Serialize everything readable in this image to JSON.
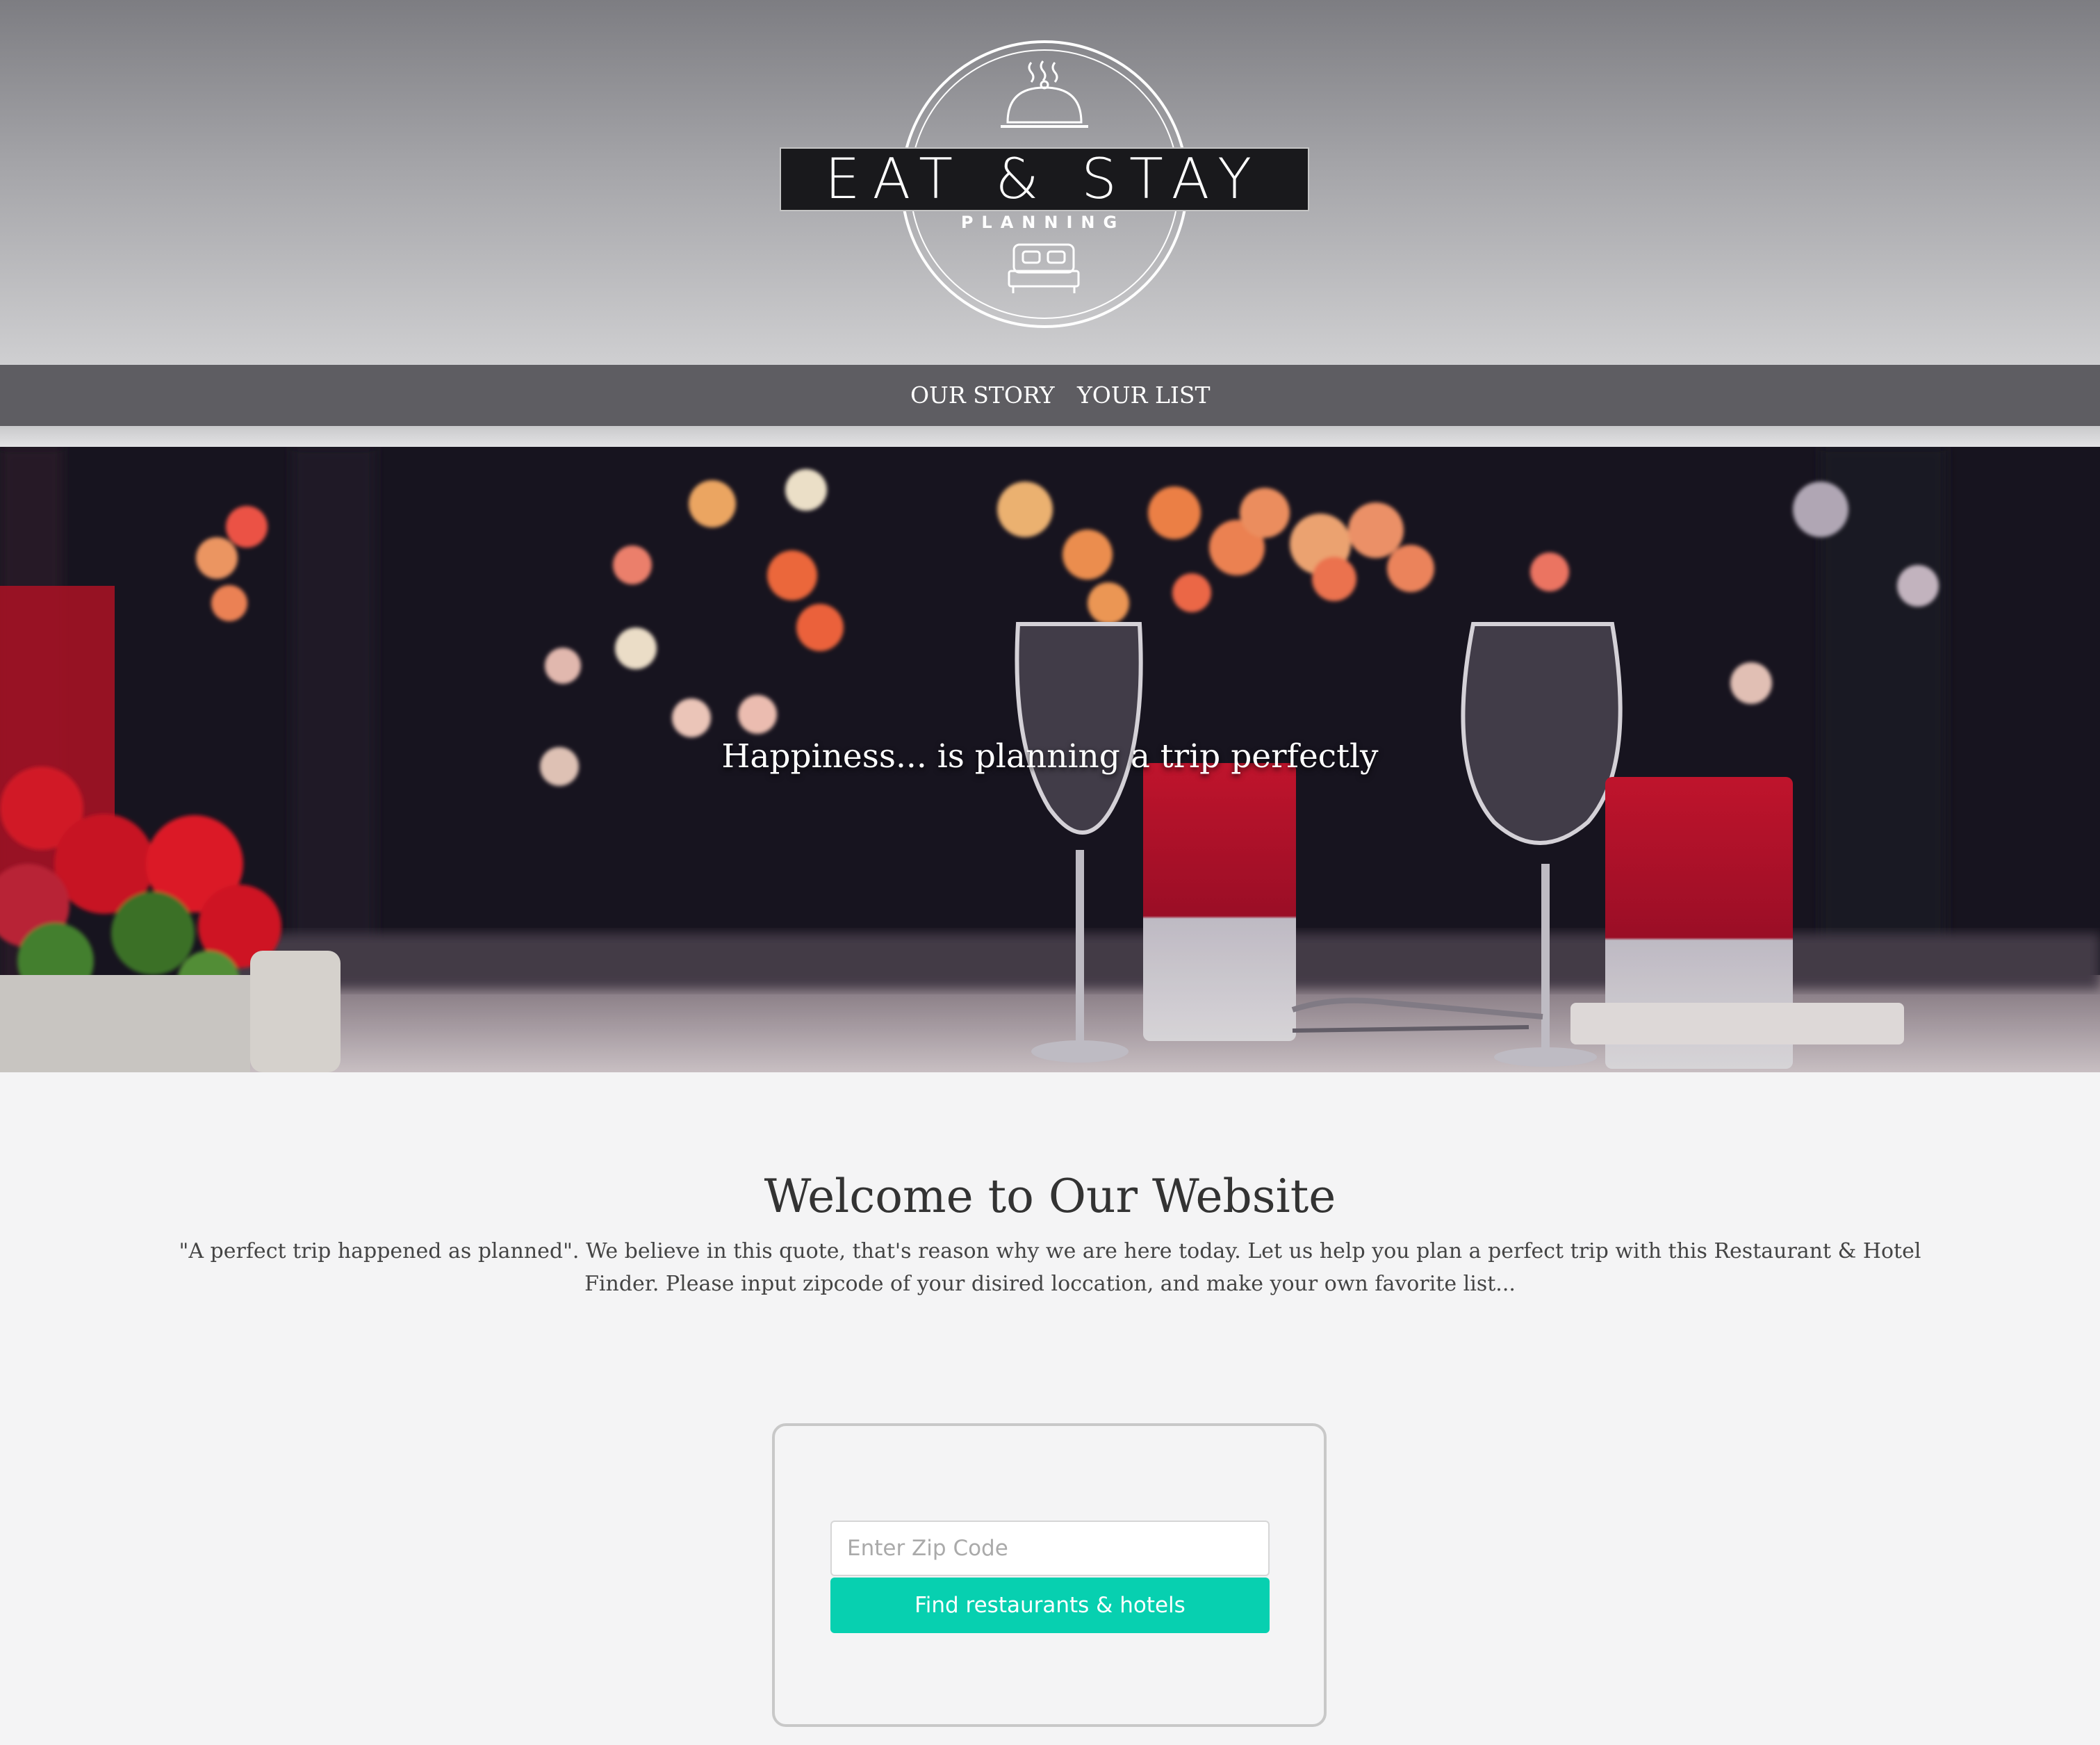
{
  "logo": {
    "title": "EAT & STAY",
    "subtitle": "PLANNING",
    "icons": [
      "cloche-icon",
      "bed-icon"
    ]
  },
  "nav": {
    "items": [
      {
        "label": "OUR STORY"
      },
      {
        "label": "YOUR LIST"
      }
    ]
  },
  "hero": {
    "tagline": "Happiness... is planning a trip perfectly"
  },
  "welcome": {
    "title": "Welcome to Our Website",
    "text": "\"A perfect trip happened as planned\". We believe in this quote, that's reason why we are here today. Let us help you plan a perfect trip with this Restaurant & Hotel Finder. Please input zipcode of your disired loccation, and make your own favorite list..."
  },
  "search": {
    "placeholder": "Enter Zip Code",
    "value": "",
    "button_label": "Find restaurants & hotels"
  },
  "colors": {
    "nav_bg": "#5e5d62",
    "button_bg": "#07d0b0",
    "logo_band": "#19191c"
  }
}
